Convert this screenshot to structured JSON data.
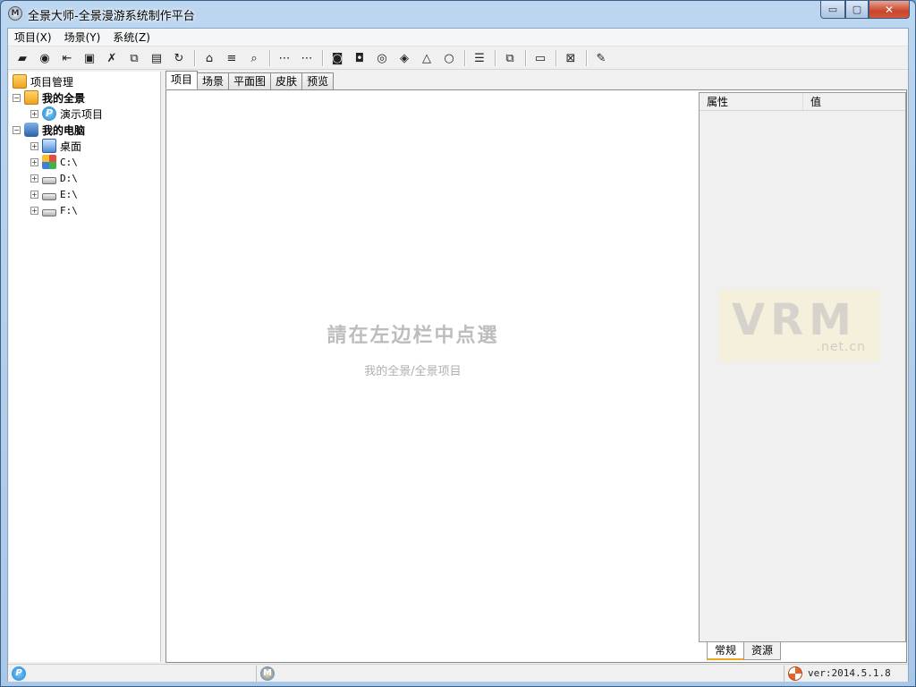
{
  "window": {
    "title": "全景大师-全景漫游系统制作平台",
    "app_icon_letter": "M",
    "min_glyph": "▭",
    "max_glyph": "▢",
    "close_glyph": "✕"
  },
  "menu": [
    {
      "label": "项目(X)"
    },
    {
      "label": "场景(Y)"
    },
    {
      "label": "系统(Z)"
    }
  ],
  "toolbar": {
    "groups": [
      [
        {
          "name": "new-project-icon",
          "glyph": "▰"
        },
        {
          "name": "pano-icon",
          "glyph": "◉"
        },
        {
          "name": "import-icon",
          "glyph": "⇤"
        },
        {
          "name": "save-icon",
          "glyph": "▣"
        },
        {
          "name": "delete-icon",
          "glyph": "✗"
        },
        {
          "name": "copy-icon",
          "glyph": "⧉"
        },
        {
          "name": "paste-icon",
          "glyph": "▤"
        },
        {
          "name": "refresh-icon",
          "glyph": "↻"
        }
      ],
      [
        {
          "name": "home-icon",
          "glyph": "⌂"
        },
        {
          "name": "list-icon",
          "glyph": "≡"
        },
        {
          "name": "find-icon",
          "glyph": "⌕"
        }
      ],
      [
        {
          "name": "split-icon",
          "glyph": "⋯"
        },
        {
          "name": "merge-icon",
          "glyph": "⋯"
        }
      ],
      [
        {
          "name": "camera-icon",
          "glyph": "◙"
        },
        {
          "name": "camera-lock-icon",
          "glyph": "◘"
        },
        {
          "name": "camera-next-icon",
          "glyph": "◎"
        },
        {
          "name": "layers-icon",
          "glyph": "◈"
        },
        {
          "name": "paint-icon",
          "glyph": "△"
        },
        {
          "name": "circle-icon",
          "glyph": "○"
        }
      ],
      [
        {
          "name": "properties-icon",
          "glyph": "☰"
        }
      ],
      [
        {
          "name": "window-icon",
          "glyph": "⧉"
        }
      ],
      [
        {
          "name": "transition-icon",
          "glyph": "▭"
        }
      ],
      [
        {
          "name": "publish-icon",
          "glyph": "⊠"
        }
      ],
      [
        {
          "name": "edit-icon",
          "glyph": "✎"
        }
      ]
    ]
  },
  "tree": {
    "root": "项目管理",
    "my_panoramas": "我的全景",
    "demo_project": "演示项目",
    "my_computer": "我的电脑",
    "desktop": "桌面",
    "drives": [
      "C:\\",
      "D:\\",
      "E:\\",
      "F:\\"
    ],
    "expand_minus": "−",
    "expand_plus": "+"
  },
  "tabs": [
    {
      "label": "项目",
      "active": true
    },
    {
      "label": "场景",
      "active": false
    },
    {
      "label": "平面图",
      "active": false
    },
    {
      "label": "皮肤",
      "active": false
    },
    {
      "label": "预览",
      "active": false
    }
  ],
  "main": {
    "hint_title": "請在左边栏中点選",
    "hint_subtitle": "我的全景/全景项目"
  },
  "properties": {
    "col_name": "属性",
    "col_value": "值",
    "logo_text": "VRM",
    "logo_domain": ".net.cn",
    "tabs": [
      {
        "label": "常规",
        "active": true
      },
      {
        "label": "资源",
        "active": false
      }
    ]
  },
  "status": {
    "pano_glyph": "P",
    "m_glyph": "M",
    "version": "ver:2014.5.1.8"
  }
}
